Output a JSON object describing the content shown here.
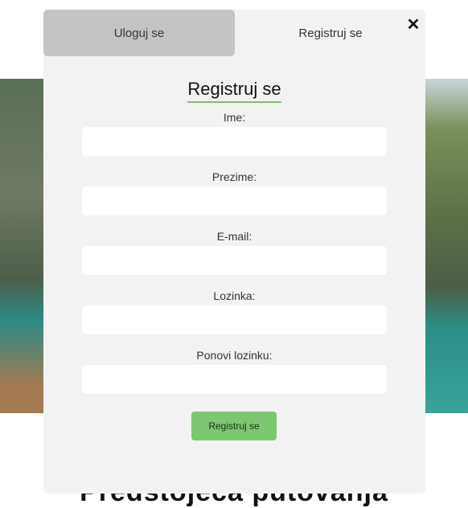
{
  "background": {
    "heading": "Predstojeća putovanja"
  },
  "tabs": {
    "login_label": "Uloguj se",
    "register_label": "Registruj se"
  },
  "close_icon": "close-icon",
  "form": {
    "title": "Registruj se",
    "fields": {
      "first_name": {
        "label": "Ime:",
        "value": ""
      },
      "last_name": {
        "label": "Prezime:",
        "value": ""
      },
      "email": {
        "label": "E-mail:",
        "value": ""
      },
      "password": {
        "label": "Lozinka:",
        "value": ""
      },
      "repeat_password": {
        "label": "Ponovi lozinku:",
        "value": ""
      }
    },
    "submit_label": "Registruj se"
  },
  "colors": {
    "accent_green": "#7cc870",
    "underline_green": "#7ac26a",
    "modal_bg": "#f2f2f2",
    "inactive_tab": "#c4c4c4"
  }
}
